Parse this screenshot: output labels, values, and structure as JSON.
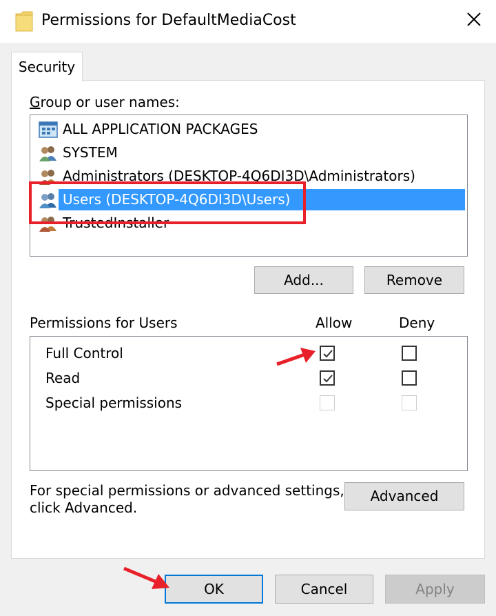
{
  "window": {
    "title": "Permissions for DefaultMediaCost",
    "folder_icon": "folder-icon",
    "close_icon": "close-icon"
  },
  "tabs": [
    {
      "label": "Security",
      "active": true
    }
  ],
  "group_section": {
    "label": "Group or user names:",
    "items": [
      {
        "label": "ALL APPLICATION PACKAGES",
        "icon": "packages-icon",
        "selected": false
      },
      {
        "label": "SYSTEM",
        "icon": "users-icon",
        "selected": false
      },
      {
        "label": "Administrators (DESKTOP-4Q6DI3D\\Administrators)",
        "icon": "users-icon",
        "selected": false
      },
      {
        "label": "Users (DESKTOP-4Q6DI3D\\Users)",
        "icon": "users-icon",
        "selected": true
      },
      {
        "label": "TrustedInstaller",
        "icon": "users-icon",
        "selected": false
      }
    ],
    "add_button": "Add...",
    "remove_button": "Remove"
  },
  "permissions": {
    "label": "Permissions for Users",
    "allow_header": "Allow",
    "deny_header": "Deny",
    "rows": [
      {
        "name": "Full Control",
        "allow": true,
        "deny": false,
        "enabled": true
      },
      {
        "name": "Read",
        "allow": true,
        "deny": false,
        "enabled": true
      },
      {
        "name": "Special permissions",
        "allow": false,
        "deny": false,
        "enabled": false
      }
    ]
  },
  "advanced": {
    "text_line1": "For special permissions or advanced settings,",
    "text_line2": "click Advanced.",
    "button": "Advanced"
  },
  "footer": {
    "ok": "OK",
    "cancel": "Cancel",
    "apply": "Apply"
  },
  "colors": {
    "selection": "#3399ff",
    "annotation_red": "#e8202a",
    "default_button_border": "#0078d7"
  }
}
